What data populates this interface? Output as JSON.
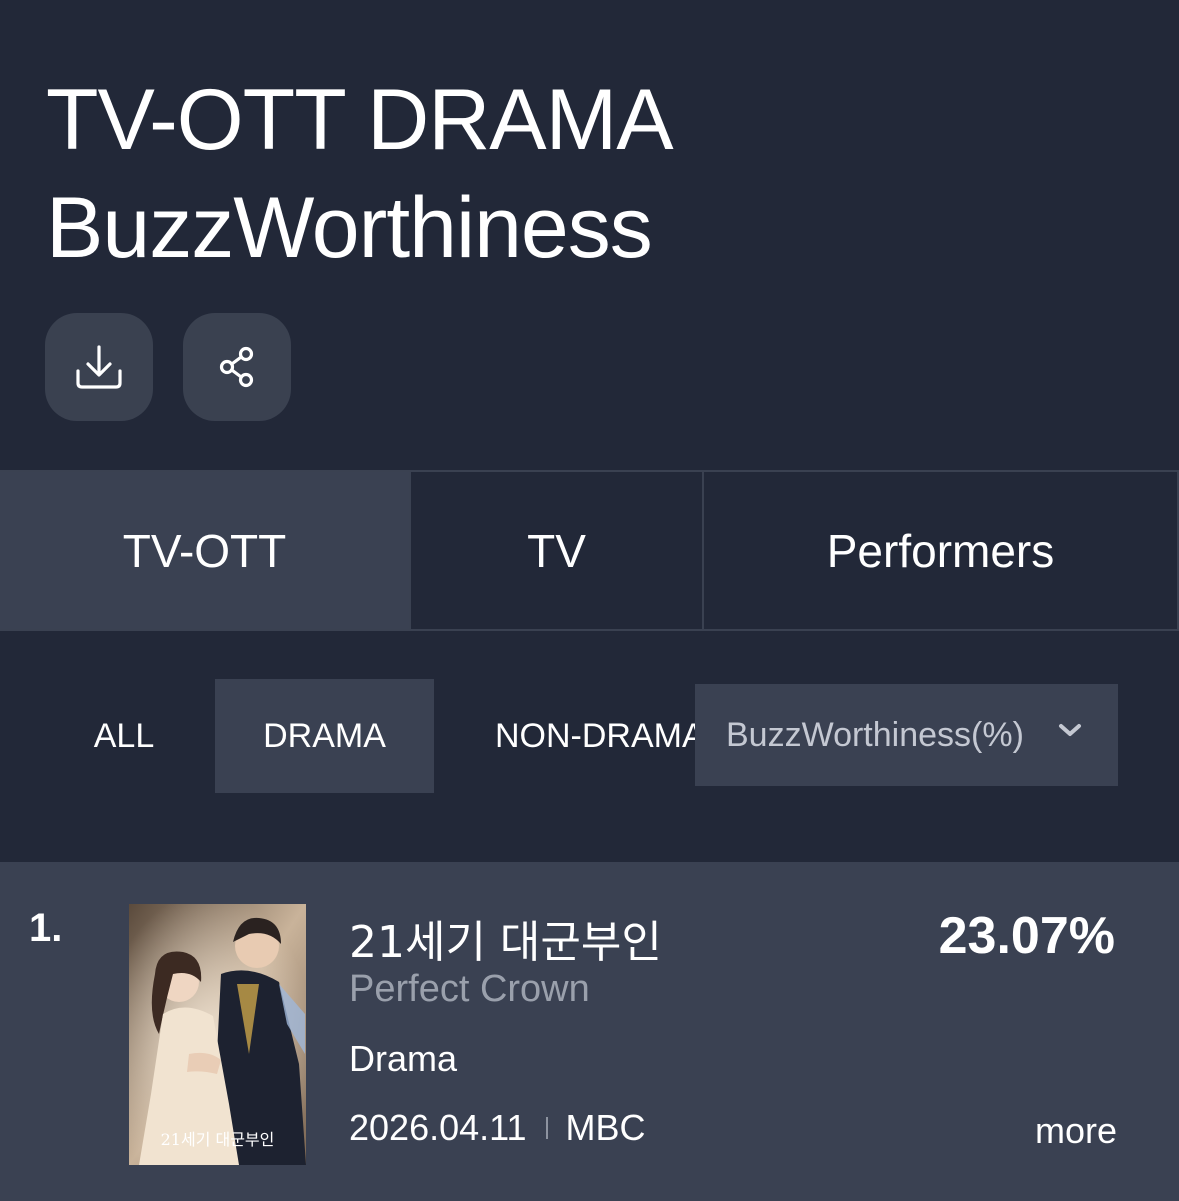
{
  "header": {
    "title_line1": "TV-OTT DRAMA",
    "title_line2": "BuzzWorthiness",
    "download_icon": "download-icon",
    "share_icon": "share-icon"
  },
  "main_tabs": [
    {
      "label": "TV-OTT",
      "active": true
    },
    {
      "label": "TV",
      "active": false
    },
    {
      "label": "Performers",
      "active": false
    }
  ],
  "sub_tabs": [
    {
      "label": "ALL",
      "active": false
    },
    {
      "label": "DRAMA",
      "active": true
    },
    {
      "label": "NON-DRAMA",
      "active": false
    }
  ],
  "metric_select": {
    "value": "BuzzWorthiness(%)",
    "icon": "chevron-down-icon"
  },
  "ranking": [
    {
      "rank": "1.",
      "title_korean": "21세기 대군부인",
      "title_english": "Perfect Crown",
      "genre": "Drama",
      "date": "2026.04.11",
      "network": "MBC",
      "score": "23.07%",
      "more_label": "more",
      "poster_title": "21세기 대군부인"
    }
  ],
  "colors": {
    "background": "#222838",
    "panel": "#3a4152",
    "muted_text": "#9aa0ac"
  }
}
